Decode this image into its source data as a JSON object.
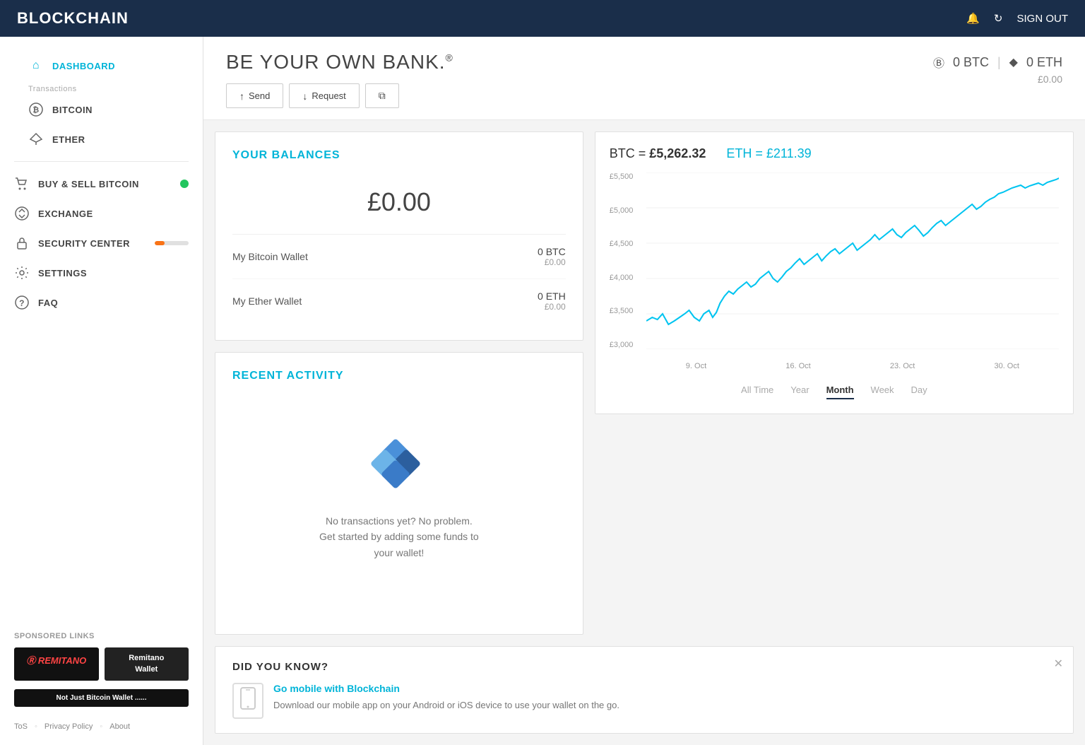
{
  "topNav": {
    "brand": "BLOCKCHAIN",
    "signOut": "SIGN OUT",
    "notifIcon": "🔔",
    "refreshIcon": "↻"
  },
  "sidebar": {
    "dashboardLabel": "DASHBOARD",
    "transactionsLabel": "Transactions",
    "items": [
      {
        "id": "bitcoin",
        "label": "BITCOIN",
        "icon": "₿"
      },
      {
        "id": "ether",
        "label": "ETHER",
        "icon": "⬡"
      }
    ],
    "buyLabel": "BUY & SELL BITCOIN",
    "exchangeLabel": "EXCHANGE",
    "securityLabel": "SECURITY CENTER",
    "settingsLabel": "SETTINGS",
    "faqLabel": "FAQ"
  },
  "sponsored": {
    "title": "SPONSORED LINKS",
    "sponsor1Name": "REMITANO",
    "sponsor2Name": "Remitano\nWallet",
    "sponsor3Name": "Not Just\nBitcoin Wallet ......"
  },
  "footer": {
    "tos": "ToS",
    "privacy": "Privacy Policy",
    "about": "About"
  },
  "mainHeader": {
    "title": "BE YOUR OWN BANK.",
    "reg": "®",
    "btcBalance": "0 BTC",
    "ethBalance": "0 ETH",
    "fiatBalance": "£0.00",
    "actions": [
      {
        "id": "send",
        "label": "Send",
        "icon": "↑"
      },
      {
        "id": "request",
        "label": "Request",
        "icon": "↓"
      },
      {
        "id": "copy",
        "label": "",
        "icon": "⧉"
      }
    ]
  },
  "balances": {
    "title": "YOUR BALANCES",
    "total": "£0.00",
    "wallets": [
      {
        "name": "My Bitcoin Wallet",
        "crypto": "0 BTC",
        "fiat": "£0.00"
      },
      {
        "name": "My Ether Wallet",
        "crypto": "0 ETH",
        "fiat": "£0.00"
      }
    ]
  },
  "recentActivity": {
    "title": "RECENT ACTIVITY",
    "emptyText": "No transactions yet? No problem.\nGet started by adding some funds to\nyour wallet!"
  },
  "chart": {
    "btcLabel": "BTC =",
    "btcValue": "£5,262.32",
    "ethLabel": "ETH =",
    "ethValue": "£211.39",
    "yLabels": [
      "£5,500",
      "£5,000",
      "£4,500",
      "£4,000",
      "£3,500",
      "£3,000"
    ],
    "xLabels": [
      "9. Oct",
      "16. Oct",
      "23. Oct",
      "30. Oct"
    ],
    "tabs": [
      {
        "id": "all-time",
        "label": "All Time"
      },
      {
        "id": "year",
        "label": "Year"
      },
      {
        "id": "month",
        "label": "Month",
        "active": true
      },
      {
        "id": "week",
        "label": "Week"
      },
      {
        "id": "day",
        "label": "Day"
      }
    ]
  },
  "didYouKnow": {
    "title": "DID YOU KNOW?",
    "linkText": "Go mobile with Blockchain",
    "desc": "Download our mobile app on your Android or iOS device to use your wallet on the go."
  }
}
